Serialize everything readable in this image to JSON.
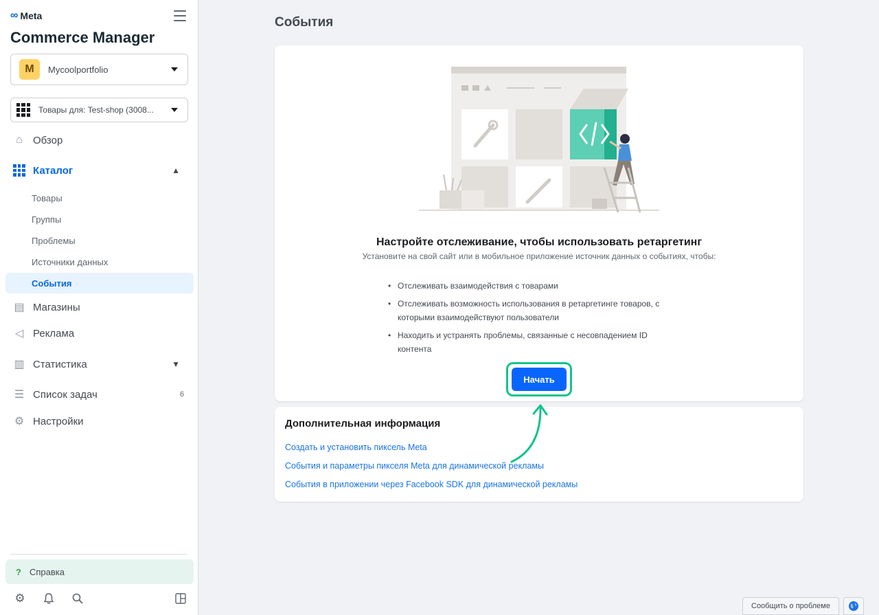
{
  "sidebar": {
    "brand": "Meta",
    "app_title": "Commerce Manager",
    "account": {
      "initial": "M",
      "name": "Mycoolportfolio"
    },
    "catalog_selector": "Товары для: Test-shop (3008...",
    "nav": {
      "overview": "Обзор",
      "catalog": "Каталог",
      "catalog_sub": [
        "Товары",
        "Группы",
        "Проблемы",
        "Источники данных",
        "События"
      ],
      "shops": "Магазины",
      "ads": "Реклама",
      "stats": "Статистика",
      "tasks": "Список задач",
      "tasks_count": "6",
      "settings": "Настройки"
    },
    "help": "Справка"
  },
  "main": {
    "page_title": "События",
    "empty_state": {
      "title": "Настройте отслеживание, чтобы использовать ретаргетинг",
      "subtitle": "Установите на свой сайт или в мобильное приложение источник данных о событиях, чтобы:",
      "bullets": [
        "Отслеживать взаимодействия с товарами",
        "Отслеживать возможность использования в ретаргетинге товаров, с которыми взаимодействуют пользователи",
        "Находить и устранять проблемы, связанные с несовпадением ID контента"
      ],
      "cta": "Начать"
    },
    "more_info": {
      "title": "Дополнительная информация",
      "links": [
        "Создать и установить пиксель Meta",
        "События и параметры пикселя Meta для динамической рекламы",
        "События в приложении через Facebook SDK для динамической рекламы"
      ]
    }
  },
  "footer": {
    "report_problem": "Сообщить о проблеме"
  },
  "colors": {
    "accent": "#0866ff",
    "highlight": "#14c38e",
    "selected_bg": "#e7f3ff"
  }
}
